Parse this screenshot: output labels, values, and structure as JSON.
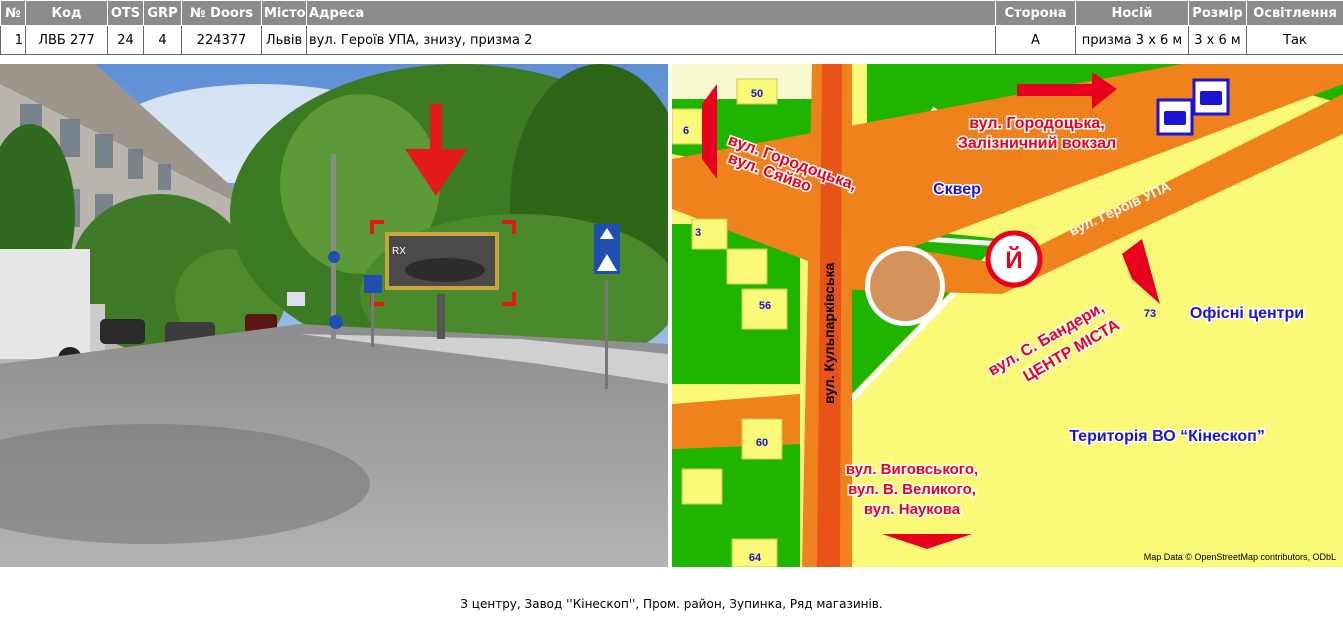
{
  "table": {
    "headers": [
      "№",
      "Код",
      "OTS",
      "GRP",
      "№ Doors",
      "Місто",
      "Адреса",
      "Сторона",
      "Носій",
      "Розмір",
      "Освітлення"
    ],
    "row": [
      "1",
      "ЛВБ 277",
      "24",
      "4",
      "224377",
      "Львів",
      "вул. Героїв УПА, знизу, призма 2",
      "А",
      "призма 3 х 6 м",
      "3 х 6 м",
      "Так"
    ]
  },
  "photo": {
    "billboard_text": "RX"
  },
  "map": {
    "labels": {
      "gorodotska_syaivo_1": "вул. Городоцька,",
      "gorodotska_syaivo_2": "вул. Сяйво",
      "gorodotska_vokzal_1": "вул. Городоцька,",
      "gorodotska_vokzal_2": "Залізничний вокзал",
      "skver": "Сквер",
      "heroiv_upa": "вул. Героїв УПА",
      "kulparkivska": "вул. Кульпарківська",
      "bandery_1": "вул. С. Бандери,",
      "bandery_2": "ЦЕНТР МІСТА",
      "ofisni": "Офісні центри",
      "kineskop": "Територія ВО “Кінескоп”",
      "vygovskoho_1": "вул. Виговського,",
      "vygovskoho_2": "вул. В. Великого,",
      "vygovskoho_3": "вул. Наукова",
      "credit": "Map Data © OpenStreetMap contributors, ODbL"
    },
    "house_numbers": [
      "50",
      "6",
      "3",
      "56",
      "73",
      "60",
      "64"
    ],
    "colors": {
      "road": "#f0821e",
      "road_center": "#e8531a",
      "green": "#1fb400",
      "yellow": "#fafa78",
      "label_red": "#e8001e",
      "label_blue": "#1c14d2"
    }
  },
  "caption": "З центру, Завод ''Кінескоп'', Пром. район, Зупинка, Ряд магазинів."
}
